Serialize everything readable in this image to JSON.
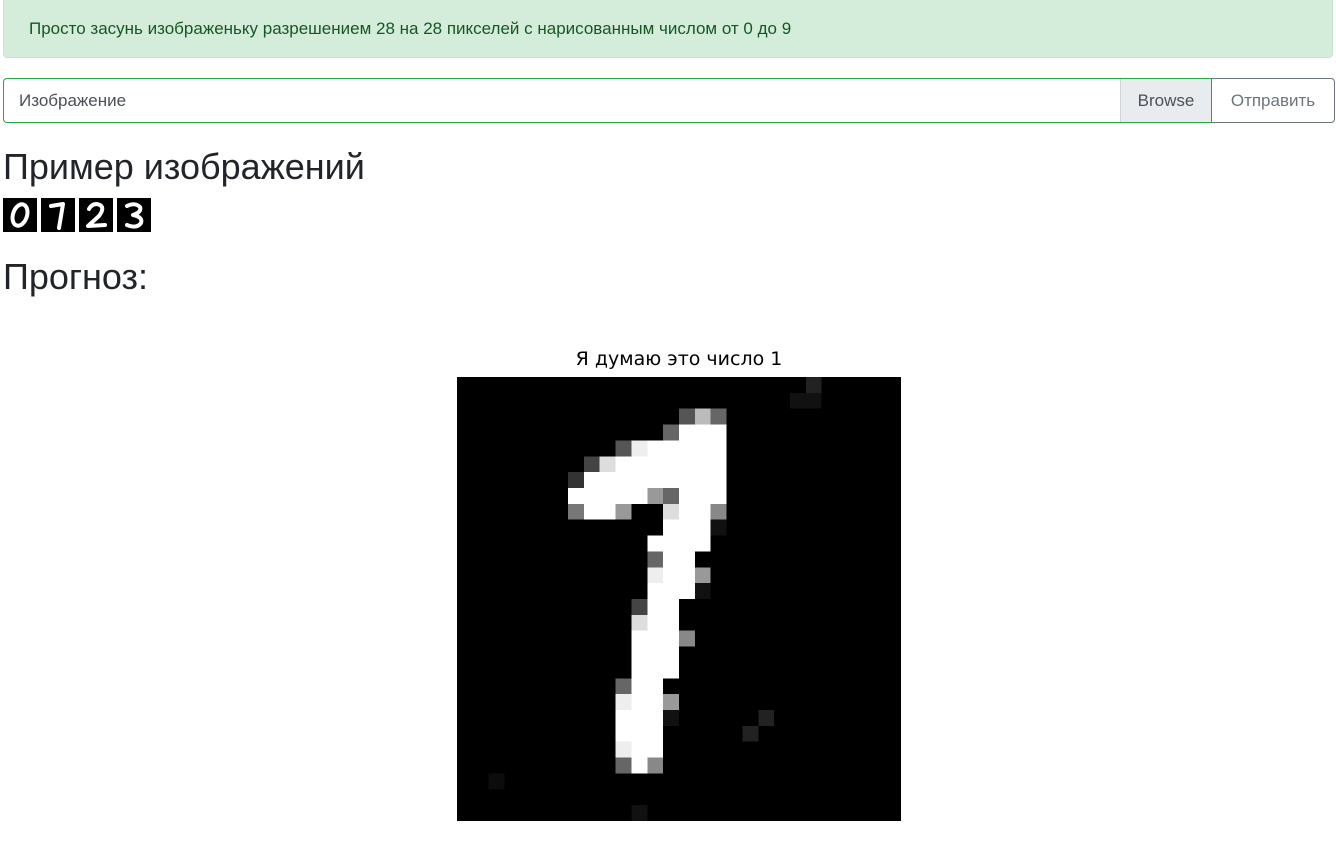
{
  "alert": {
    "text": "Просто засунь изображеньку разрешением 28 на 28 пикселей с нарисованным числом от 0 до 9"
  },
  "upload": {
    "file_label": "Изображение",
    "browse_label": "Browse",
    "submit_label": "Отправить"
  },
  "examples": {
    "heading": "Пример изображений",
    "digits": [
      "0",
      "1",
      "2",
      "3"
    ]
  },
  "forecast": {
    "heading": "Прогноз:",
    "plot_title": "Я думаю это число 1"
  },
  "colors": {
    "alert_bg": "#d4edda",
    "alert_text": "#155724",
    "input_border": "#28a745",
    "button_border": "#6c757d"
  }
}
